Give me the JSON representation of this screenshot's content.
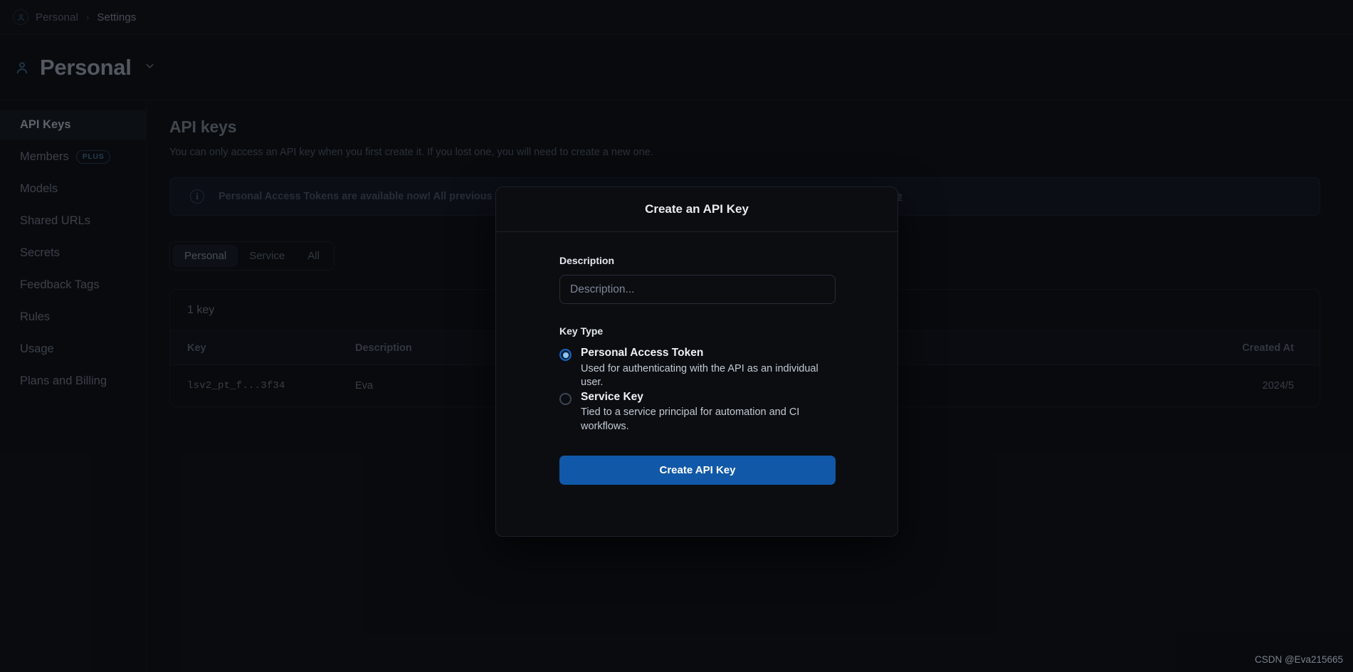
{
  "breadcrumb": {
    "avatar_icon": "user-icon",
    "items": [
      "Personal",
      "Settings"
    ],
    "separator": "›"
  },
  "workspace": {
    "icon": "user-icon",
    "title": "Personal",
    "chevron_icon": "chevron-down-icon"
  },
  "sidebar": {
    "items": [
      {
        "label": "API Keys",
        "active": true
      },
      {
        "label": "Members",
        "badge": "PLUS",
        "active": false
      },
      {
        "label": "Models",
        "active": false
      },
      {
        "label": "Shared URLs",
        "active": false
      },
      {
        "label": "Secrets",
        "active": false
      },
      {
        "label": "Feedback Tags",
        "active": false
      },
      {
        "label": "Rules",
        "active": false
      },
      {
        "label": "Usage",
        "active": false
      },
      {
        "label": "Plans and Billing",
        "active": false
      }
    ]
  },
  "main": {
    "title": "API keys",
    "subtitle": "You can only access an API key when you first create it. If you lost one, you will need to create a new one.",
    "notice": {
      "icon": "info-icon",
      "text": "Personal Access Tokens are available now! All previous API keys have been converted to Service Keys. You can find more information ",
      "link_text": "here"
    },
    "filters": [
      {
        "label": "Personal",
        "active": true
      },
      {
        "label": "Service",
        "active": false
      },
      {
        "label": "All",
        "active": false
      }
    ],
    "table": {
      "count_label": "1 key",
      "columns": [
        "Key",
        "Description",
        "Created At"
      ],
      "rows": [
        {
          "key": "lsv2_pt_f...3f34",
          "description": "Eva",
          "created": "2024/5"
        }
      ]
    }
  },
  "modal": {
    "title": "Create an API Key",
    "description_label": "Description",
    "description_value": "",
    "description_placeholder": "Description...",
    "keytype_label": "Key Type",
    "options": [
      {
        "name": "Personal Access Token",
        "desc": "Used for authenticating with the API as an individual user.",
        "selected": true
      },
      {
        "name": "Service Key",
        "desc": "Tied to a service principal for automation and CI workflows.",
        "selected": false
      }
    ],
    "submit_label": "Create API Key"
  },
  "watermark": "CSDN @Eva215665",
  "colors": {
    "accent_blue": "#1159a8",
    "radio_blue": "#8fc4f5",
    "page_bg": "#0e1014",
    "modal_bg": "#0b0d11"
  }
}
